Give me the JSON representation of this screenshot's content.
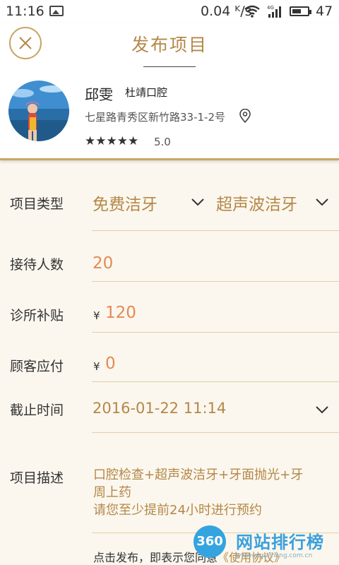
{
  "status_bar": {
    "time": "11:16",
    "speed": "0.04 ᴷ/s",
    "network": "4G",
    "battery_level": "47"
  },
  "header": {
    "title": "发布项目",
    "user": {
      "name": "邱雯",
      "clinic": "杜靖口腔",
      "address": "七星路青秀区新竹路33-1-2号",
      "stars": "★★★★★",
      "rating": "5.0"
    }
  },
  "form": {
    "project_type": {
      "label": "项目类型",
      "category": "免费洁牙",
      "item": "超声波洁牙"
    },
    "capacity": {
      "label": "接待人数",
      "value": "20"
    },
    "clinic_subsidy": {
      "label": "诊所补贴",
      "currency": "¥",
      "value": "120"
    },
    "customer_pay": {
      "label": "顾客应付",
      "currency": "¥",
      "value": "0"
    },
    "deadline": {
      "label": "截止时间",
      "value": "2016-01-22 11:14"
    },
    "description": {
      "label": "项目描述",
      "line1": "口腔检查+超声波洁牙+牙面抛光+牙",
      "line2": "周上药",
      "line3": "请您至少提前24小时进行预约"
    }
  },
  "agreement": {
    "text": "点击发布，即表示您同意",
    "link": "《使用协议》"
  },
  "watermark": {
    "badge": "360",
    "text": "网站排行榜",
    "url": "www.wzpaihang.com.cn"
  },
  "colors": {
    "accent": "#b48748",
    "number": "#e38a55",
    "background": "#fbf7ee"
  }
}
